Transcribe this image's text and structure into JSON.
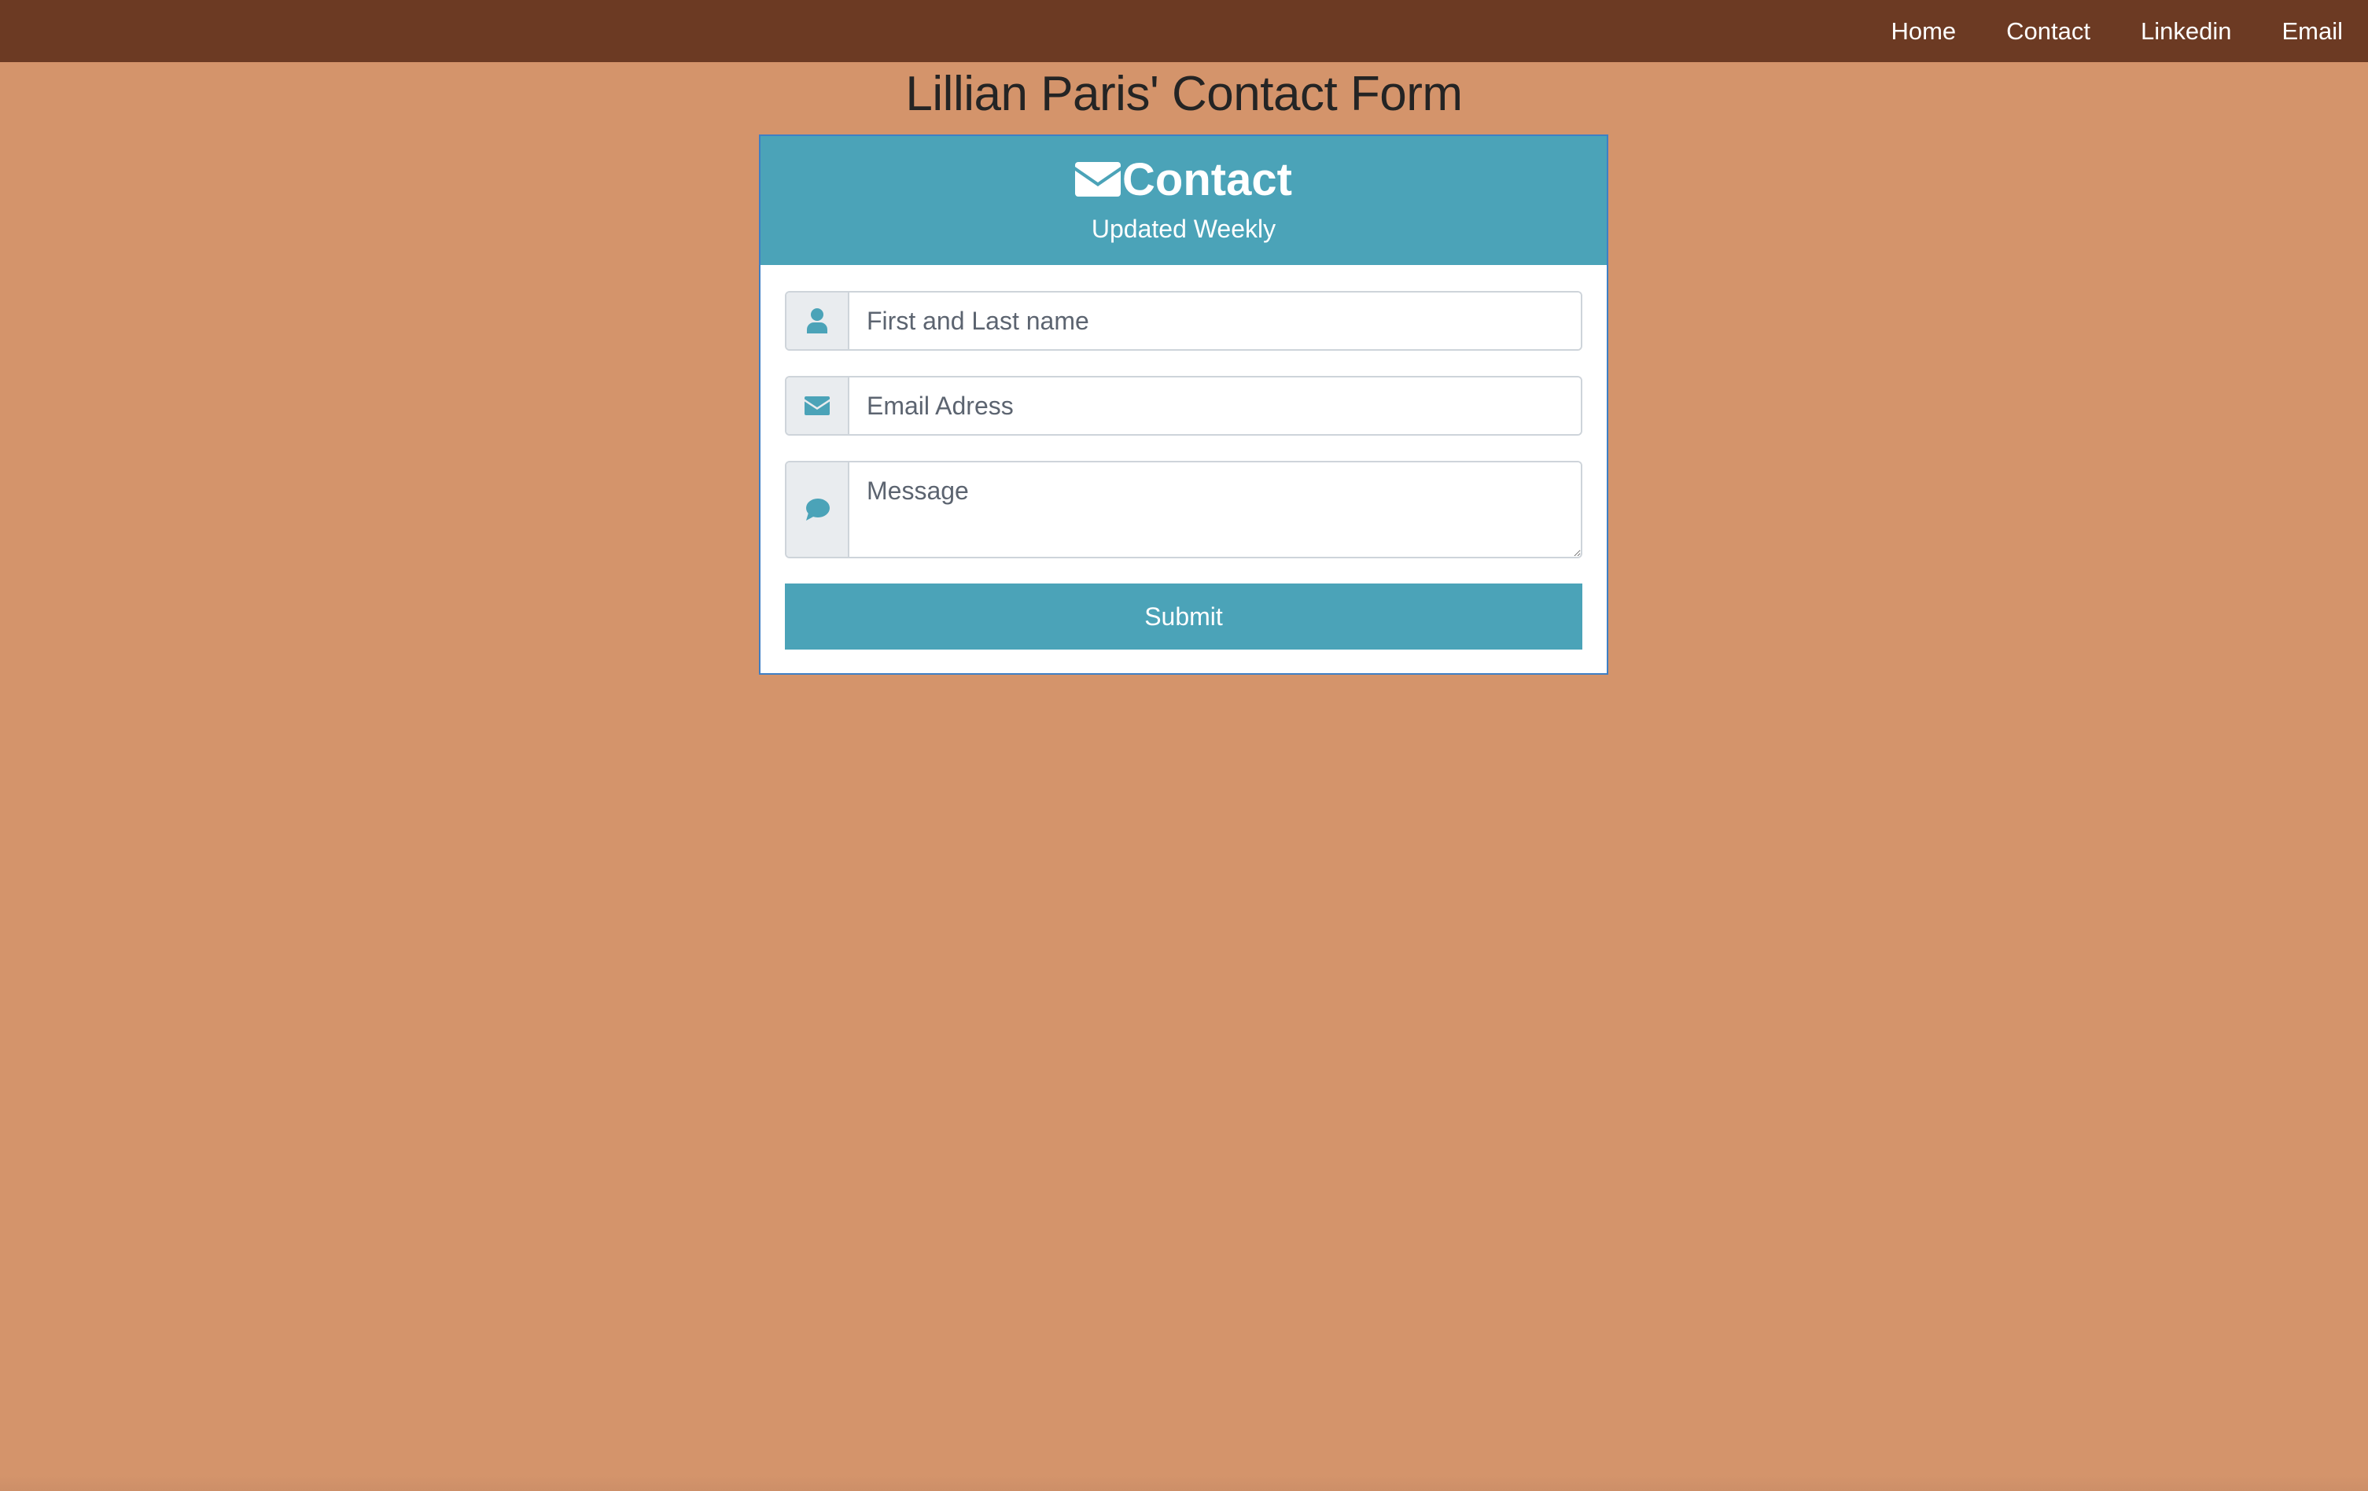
{
  "nav": {
    "items": [
      {
        "label": "Home"
      },
      {
        "label": "Contact"
      },
      {
        "label": "Linkedin"
      },
      {
        "label": "Email"
      }
    ]
  },
  "page": {
    "title": "Lillian Paris' Contact Form"
  },
  "card": {
    "heading": "Contact",
    "heading_icon": "envelope-icon",
    "subtitle": "Updated Weekly"
  },
  "form": {
    "name_field": {
      "placeholder": "First and Last name",
      "value": "",
      "icon": "user-icon"
    },
    "email_field": {
      "placeholder": "Email Adress",
      "value": "",
      "icon": "envelope-icon"
    },
    "message_field": {
      "placeholder": "Message",
      "value": "",
      "icon": "comment-icon"
    },
    "submit_label": "Submit"
  },
  "colors": {
    "background": "#d4946b",
    "navbar": "#6c3a23",
    "accent": "#4ba3b8",
    "card_border": "#3f7fc4",
    "title_text": "#242424"
  }
}
